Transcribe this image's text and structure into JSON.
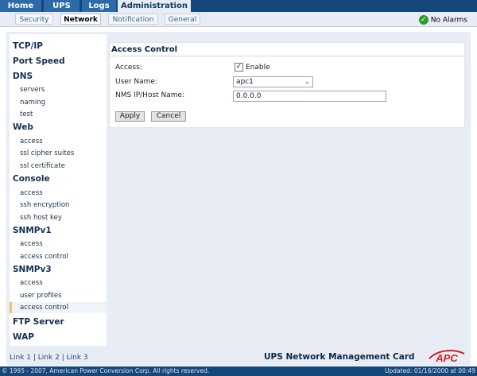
{
  "top_tabs": [
    "Home",
    "UPS",
    "Logs",
    "Administration"
  ],
  "sub_tabs": [
    "Security",
    "Network",
    "Notification",
    "General"
  ],
  "alarm": {
    "text": "No Alarms",
    "icon": "check-circle-icon",
    "color": "#2e9b2a"
  },
  "sidebar": {
    "tcpip": "TCP/IP",
    "port_speed": "Port Speed",
    "dns": {
      "label": "DNS",
      "items": [
        "servers",
        "naming",
        "test"
      ]
    },
    "web": {
      "label": "Web",
      "items": [
        "access",
        "ssl cipher suites",
        "ssl certificate"
      ]
    },
    "console": {
      "label": "Console",
      "items": [
        "access",
        "ssh encryption",
        "ssh host key"
      ]
    },
    "snmpv1": {
      "label": "SNMPv1",
      "items": [
        "access",
        "access control"
      ]
    },
    "snmpv3": {
      "label": "SNMPv3",
      "items": [
        "access",
        "user profiles",
        "access control"
      ]
    },
    "ftp": "FTP Server",
    "wap": "WAP"
  },
  "panel": {
    "title": "Access Control",
    "access_label": "Access:",
    "enable_label": "Enable",
    "enable_checked": true,
    "user_label": "User Name:",
    "user_value": "apc1",
    "host_label": "NMS IP/Host Name:",
    "host_value": "0.0.0.0",
    "apply": "Apply",
    "cancel": "Cancel"
  },
  "links": [
    "Link 1",
    "Link 2",
    "Link 3"
  ],
  "link_separator": " | ",
  "card_title": "UPS Network Management Card",
  "logo_text": "APC",
  "footer": {
    "copyright": "© 1995 - 2007, American Power Conversion Corp. All rights reserved.",
    "updated": "Updated: 01/16/2000 at 00:49"
  },
  "colors": {
    "header": "#16477a",
    "tab": "#2c6aa8",
    "brand_red": "#d0202a"
  }
}
